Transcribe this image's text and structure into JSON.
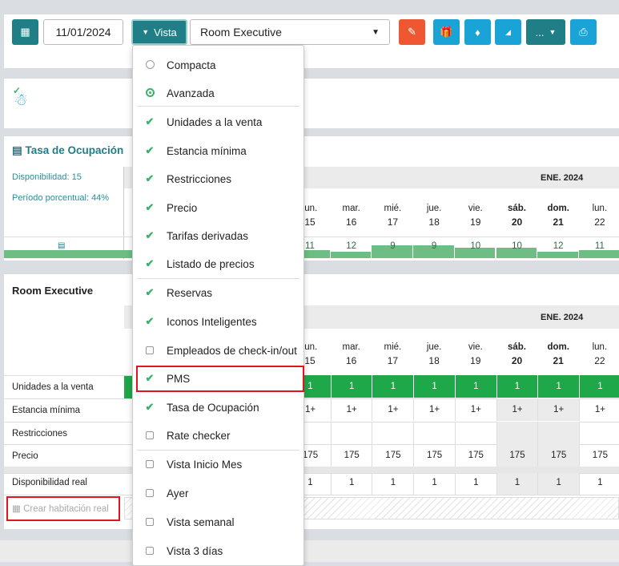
{
  "toolbar": {
    "date": "11/01/2024",
    "vista_label": "Vista",
    "room_select": "Room Executive",
    "more_label": "..."
  },
  "colors": {
    "teal": "#207e86",
    "blue": "#1aa3d6",
    "red": "#ef5733",
    "green": "#1ea84a",
    "bar_green": "#6dbd84"
  },
  "occupancy": {
    "title": "Tasa de Ocupación",
    "availability": "Disponibilidad: 15",
    "period": "Período porcentual: 44%",
    "month": "ENE. 2024",
    "values": [
      "11",
      "12",
      "9",
      "9",
      "10",
      "10",
      "12",
      "11"
    ],
    "fill_values": [
      11,
      12,
      9,
      9,
      10,
      10,
      12,
      11
    ]
  },
  "days": [
    {
      "dow": "lun.",
      "d": "15"
    },
    {
      "dow": "mar.",
      "d": "16"
    },
    {
      "dow": "mié.",
      "d": "17"
    },
    {
      "dow": "jue.",
      "d": "18"
    },
    {
      "dow": "vie.",
      "d": "19"
    },
    {
      "dow": "sáb.",
      "d": "20"
    },
    {
      "dow": "dom.",
      "d": "21"
    },
    {
      "dow": "lun.",
      "d": "22"
    }
  ],
  "room": {
    "title": "Room Executive",
    "month": "ENE. 2024",
    "rows": [
      {
        "label": "Unidades a la venta",
        "values": [
          "1",
          "1",
          "1",
          "1",
          "1",
          "1",
          "1",
          "1"
        ]
      },
      {
        "label": "Estancia mínima",
        "values": [
          "1+",
          "1+",
          "1+",
          "1+",
          "1+",
          "1+",
          "1+",
          "1+"
        ]
      },
      {
        "label": "Restricciones",
        "values": [
          "",
          "",
          "",
          "",
          "",
          "",
          "",
          ""
        ]
      },
      {
        "label": "Precio",
        "values": [
          "175",
          "175",
          "175",
          "175",
          "175",
          "175",
          "175",
          "175"
        ]
      }
    ],
    "real": {
      "label": "Disponibilidad real",
      "values": [
        "1",
        "1",
        "1",
        "1",
        "1",
        "1",
        "1",
        "1"
      ]
    },
    "create_label": "Crear habitación real"
  },
  "menu": [
    {
      "label": "Compacta",
      "type": "radio",
      "on": false
    },
    {
      "label": "Avanzada",
      "type": "radio",
      "on": true
    },
    {
      "label": "Unidades a la venta",
      "type": "check",
      "on": true
    },
    {
      "label": "Estancia mínima",
      "type": "check",
      "on": true
    },
    {
      "label": "Restricciones",
      "type": "check",
      "on": true
    },
    {
      "label": "Precio",
      "type": "check",
      "on": true
    },
    {
      "label": "Tarifas derivadas",
      "type": "check",
      "on": true
    },
    {
      "label": "Listado de precios",
      "type": "check",
      "on": true
    },
    {
      "label": "Reservas",
      "type": "check",
      "on": true
    },
    {
      "label": "Iconos Inteligentes",
      "type": "check",
      "on": true
    },
    {
      "label": "Empleados de check-in/out",
      "type": "check",
      "on": false
    },
    {
      "label": "PMS",
      "type": "check",
      "on": true
    },
    {
      "label": "Tasa de Ocupación",
      "type": "check",
      "on": true
    },
    {
      "label": "Rate checker",
      "type": "check",
      "on": false
    },
    {
      "label": "Vista Inicio Mes",
      "type": "check",
      "on": false
    },
    {
      "label": "Ayer",
      "type": "check",
      "on": false
    },
    {
      "label": "Vista semanal",
      "type": "check",
      "on": false
    },
    {
      "label": "Vista 3 días",
      "type": "check",
      "on": false
    }
  ]
}
